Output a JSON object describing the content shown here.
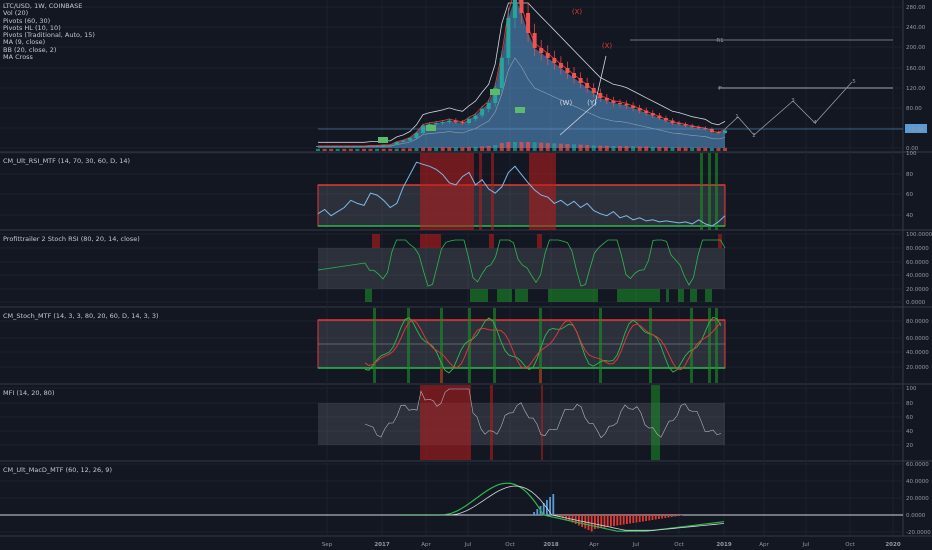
{
  "header": {
    "symbol": "LTC/USD, 1W, COINBASE",
    "indicators": [
      "Vol (20)",
      "Pivots (60, 30)",
      "Pivots HL (10, 10)",
      "Pivots (Traditional, Auto, 15)",
      "MA (9, close)",
      "BB (20, close, 2)",
      "MA Cross"
    ]
  },
  "colors": {
    "bg": "#131722",
    "up": "#26a69a",
    "down": "#ef5350",
    "price": "#5b9bd5",
    "green": "#2db84d",
    "red": "#e53935",
    "band_fill": "#2a2e39"
  },
  "chart_data": [
    {
      "panel": "price",
      "type": "line",
      "title": "",
      "x": [
        "Sep",
        "2017",
        "Apr",
        "Jul",
        "Oct",
        "2018",
        "Apr",
        "Jul",
        "Oct",
        "2019",
        "Apr",
        "Jul",
        "Oct",
        "2020"
      ],
      "yticks": [
        "280.00",
        "240.00",
        "200.00",
        "160.00",
        "120.00",
        "80.00",
        "40.00",
        "0.00"
      ],
      "last_price": "35.06",
      "series": [
        {
          "name": "",
          "values": [
            4,
            4,
            4,
            4,
            4,
            4,
            4,
            4,
            5,
            5,
            6,
            6,
            12,
            15,
            20,
            30,
            45,
            48,
            50,
            52,
            55,
            52,
            50,
            58,
            65,
            78,
            90,
            120,
            180,
            260,
            300,
            270,
            230,
            200,
            190,
            180,
            170,
            160,
            150,
            140,
            130,
            120,
            110,
            100,
            95,
            90,
            88,
            85,
            80,
            75,
            70,
            65,
            60,
            55,
            50,
            48,
            45,
            42,
            40,
            38,
            32,
            30,
            35
          ]
        }
      ],
      "annotations": [
        "(X)",
        "(X)",
        "(W)",
        "(Y)",
        "1",
        "2",
        "3",
        "4",
        "5",
        "R1",
        "P"
      ]
    },
    {
      "panel": "rsi",
      "type": "line",
      "title": "CM_Ult_RSI_MTF (14, 70, 30, 60, D, 14)",
      "yticks": [
        "100",
        "80",
        "60",
        "40"
      ],
      "values": [
        42,
        46,
        40,
        44,
        48,
        55,
        52,
        50,
        62,
        60,
        55,
        48,
        52,
        68,
        80,
        92,
        90,
        88,
        85,
        80,
        72,
        70,
        78,
        82,
        70,
        75,
        66,
        62,
        68,
        82,
        88,
        80,
        72,
        65,
        60,
        58,
        52,
        55,
        50,
        54,
        48,
        52,
        45,
        42,
        40,
        44,
        38,
        40,
        36,
        38,
        35,
        36,
        34,
        35,
        34,
        33,
        34,
        32,
        36,
        32,
        30,
        34,
        40
      ]
    },
    {
      "panel": "stoch_rsi",
      "type": "line",
      "title": "Profittrailer 2 Stoch RSI (80, 20, 14, close)",
      "yticks": [
        "100.0000",
        "80.0000",
        "60.0000",
        "40.0000",
        "20.0000",
        "0.0000"
      ]
    },
    {
      "panel": "stoch",
      "type": "line",
      "title": "CM_Stoch_MTF (14, 3, 3, 80, 20, 60, D, 14, 3, 3)",
      "yticks": [
        "80.0000",
        "60.0000",
        "40.0000",
        "20.0000"
      ]
    },
    {
      "panel": "mfi",
      "type": "line",
      "title": "MFI (14, 20, 80)",
      "yticks": [
        "100",
        "80",
        "60",
        "40",
        "20"
      ]
    },
    {
      "panel": "macd",
      "type": "line",
      "title": "CM_Ult_MacD_MTF (60, 12, 26, 9)",
      "yticks": [
        "60.0000",
        "40.0000",
        "20.0000",
        "0.0000",
        "-20.0000"
      ]
    }
  ]
}
